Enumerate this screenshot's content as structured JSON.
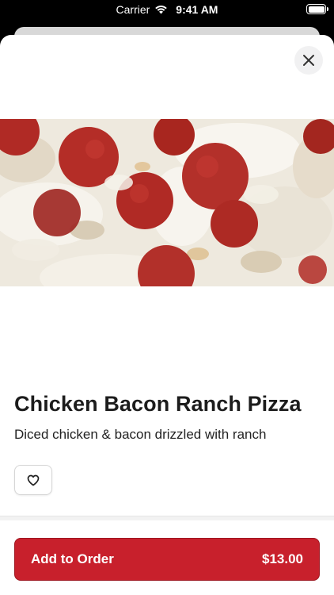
{
  "status_bar": {
    "carrier": "Carrier",
    "time": "9:41 AM",
    "icons": [
      "wifi-icon",
      "battery-icon"
    ]
  },
  "item": {
    "name": "Chicken Bacon Ranch Pizza",
    "description": "Diced chicken & bacon drizzled with ranch"
  },
  "actions": {
    "close_icon": "close-icon",
    "favorite_icon": "heart-icon",
    "add_to_order_label": "Add to Order",
    "price": "$13.00"
  },
  "colors": {
    "accent": "#c8202c",
    "pepperoni": "#b02a25"
  }
}
